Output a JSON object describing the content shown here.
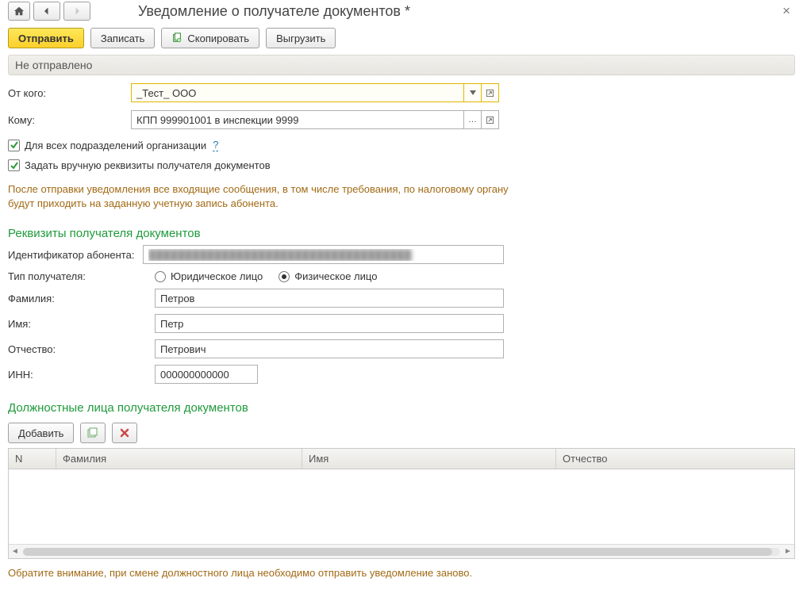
{
  "window": {
    "title": "Уведомление о получателе документов *"
  },
  "toolbar": {
    "send": "Отправить",
    "write": "Записать",
    "copy": "Скопировать",
    "export": "Выгрузить"
  },
  "status": "Не отправлено",
  "fields": {
    "from_label": "От кого:",
    "from_value": "_Тест_ ООО",
    "to_label": "Кому:",
    "to_value": "КПП 999901001 в инспекции 9999"
  },
  "checks": {
    "all_divisions": "Для всех подразделений организации",
    "manual_req": "Задать вручную реквизиты получателя документов"
  },
  "notice": "После отправки уведомления все входящие сообщения, в том числе требования, по налоговому органу будут приходить на заданную учетную запись абонента.",
  "recipient_section": {
    "title": "Реквизиты получателя документов",
    "abonent_id_label": "Идентификатор абонента:",
    "abonent_id_value": "████████████████████████████████████",
    "type_label": "Тип получателя:",
    "radio_legal": "Юридическое лицо",
    "radio_person": "Физическое лицо",
    "lastname_label": "Фамилия:",
    "lastname_value": "Петров",
    "firstname_label": "Имя:",
    "firstname_value": "Петр",
    "middlename_label": "Отчество:",
    "middlename_value": "Петрович",
    "inn_label": "ИНН:",
    "inn_value": "000000000000"
  },
  "officials_section": {
    "title": "Должностные лица получателя документов",
    "add": "Добавить",
    "columns": {
      "n": "N",
      "lastname": "Фамилия",
      "firstname": "Имя",
      "middlename": "Отчество"
    }
  },
  "footnote": "Обратите внимание, при смене должностного лица необходимо отправить уведомление заново."
}
